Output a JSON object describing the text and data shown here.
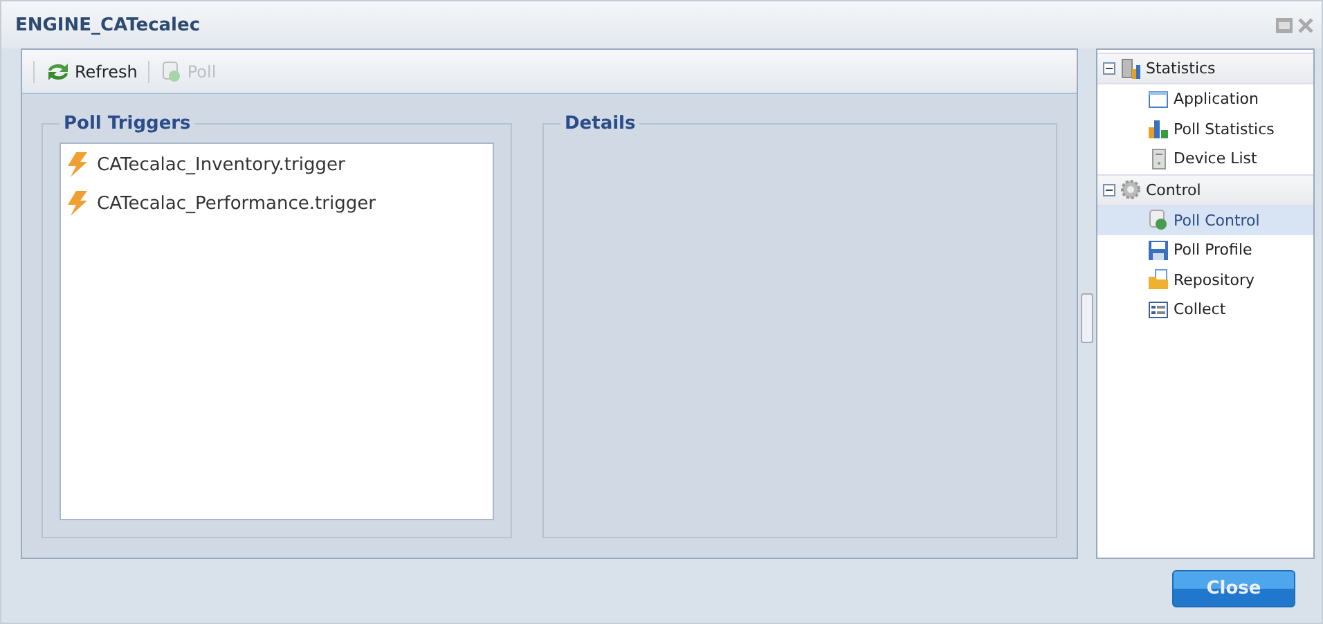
{
  "window": {
    "title": "ENGINE_CATecalec"
  },
  "toolbar": [
    {
      "label": "Refresh",
      "disabled": false
    },
    {
      "label": "Poll",
      "disabled": true
    }
  ],
  "poll_triggers": {
    "title": "Poll Triggers",
    "items": [
      {
        "label": "CATecalac_Inventory.trigger"
      },
      {
        "label": "CATecalac_Performance.trigger"
      }
    ]
  },
  "details": {
    "title": "Details"
  },
  "tree": [
    {
      "label": "Statistics",
      "expanded": true,
      "children": [
        {
          "label": "Application",
          "selected": false
        },
        {
          "label": "Poll Statistics",
          "selected": false
        },
        {
          "label": "Device List",
          "selected": false
        }
      ]
    },
    {
      "label": "Control",
      "expanded": true,
      "children": [
        {
          "label": "Poll Control",
          "selected": true
        },
        {
          "label": "Poll Profile",
          "selected": false
        },
        {
          "label": "Repository",
          "selected": false
        },
        {
          "label": "Collect",
          "selected": false
        }
      ]
    }
  ],
  "buttons": [
    {
      "label": "Close"
    }
  ]
}
